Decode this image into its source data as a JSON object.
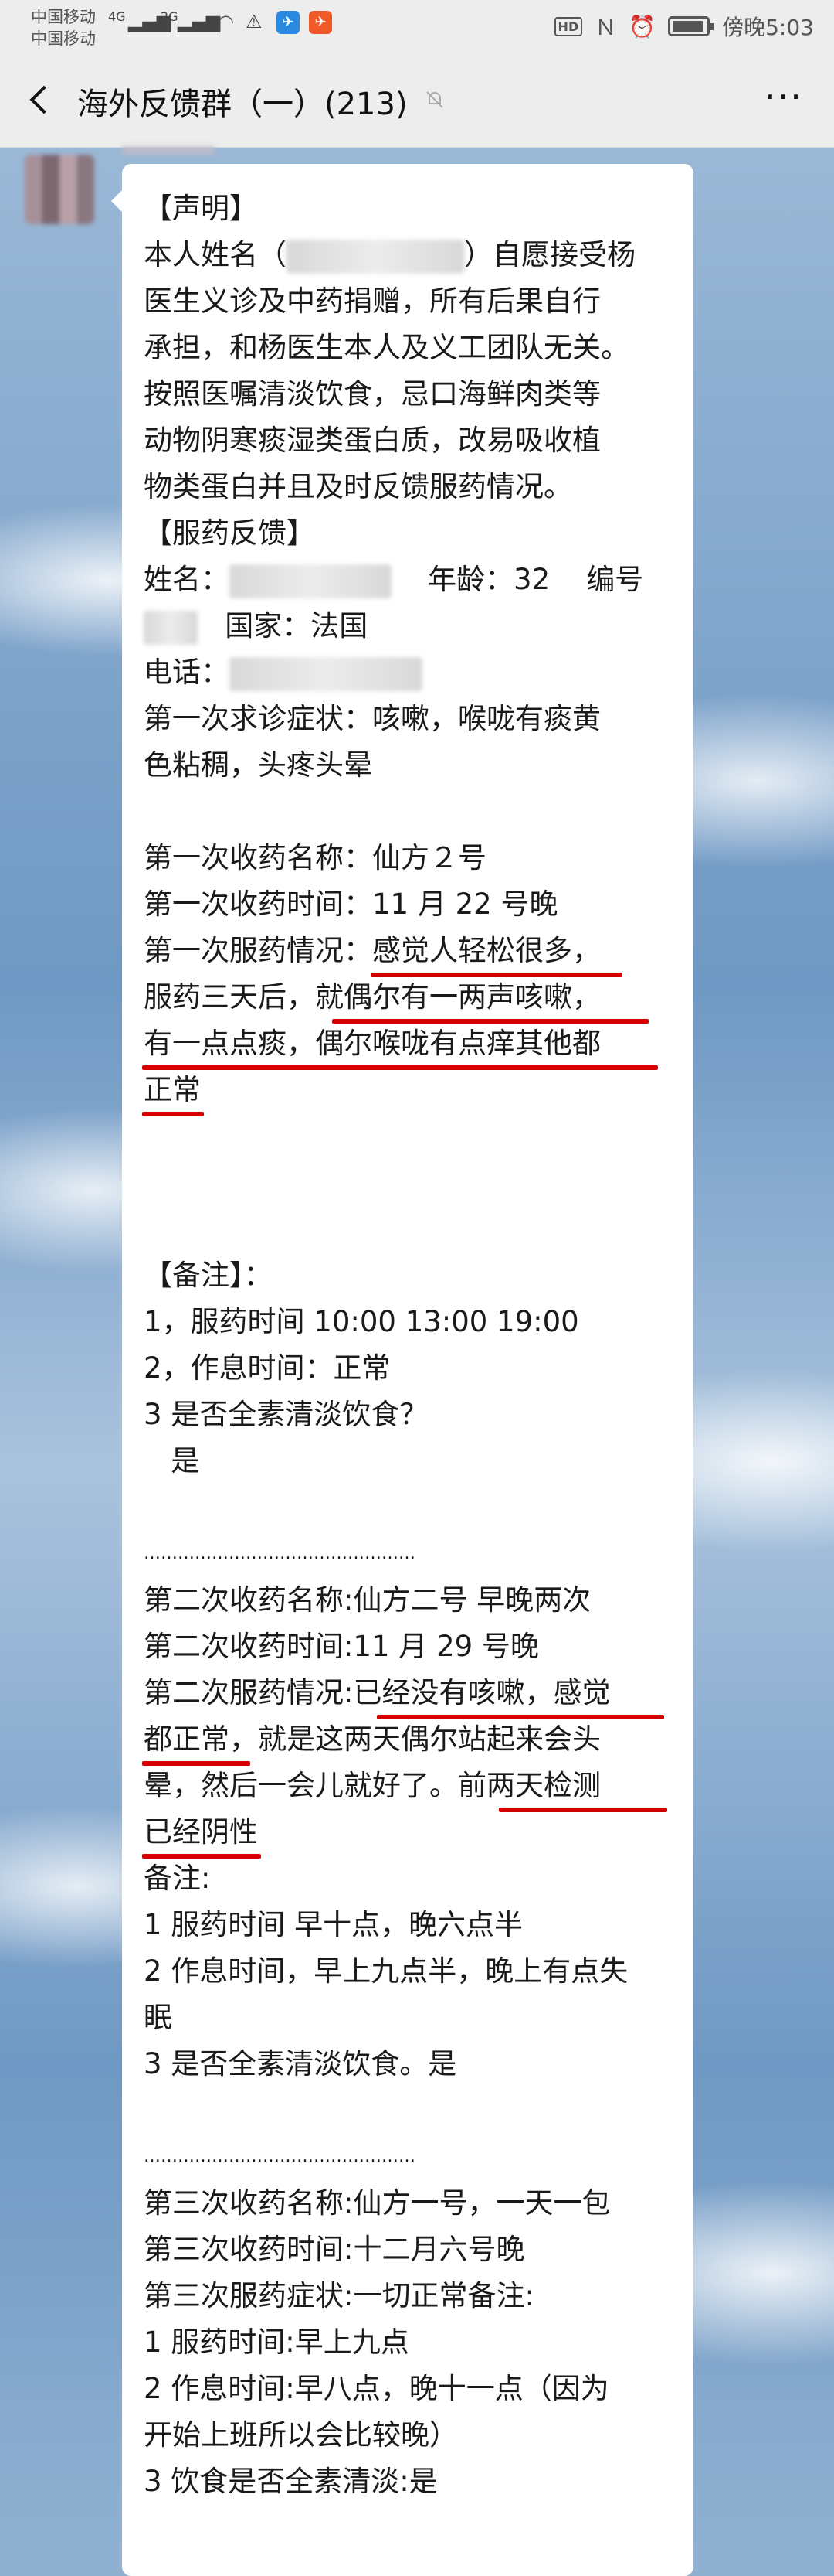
{
  "status_bar": {
    "carrier1": "中国移动",
    "carrier2": "中国移动",
    "net1": "4G",
    "net2": "2G",
    "time": "傍晚5:03"
  },
  "header": {
    "title": "海外反馈群（一）(213)",
    "more": "···"
  },
  "message": {
    "lines": [
      "【声明】",
      "本人姓名（",
      "）自愿接受杨",
      "医生义诊及中药捐赠，所有后果自行",
      "承担，和杨医生本人及义工团队无关。",
      "按照医嘱清淡饮食，忌口海鲜肉类等",
      "动物阴寒痰湿类蛋白质，改易吸收植",
      "物类蛋白并且及时反馈服药情况。",
      "【服药反馈】",
      "姓名：",
      "年龄：32",
      "编号",
      "国家：法国",
      "电话：",
      "第一次求诊症状：咳嗽，喉咙有痰黄",
      "色粘稠，头疼头晕",
      "第一次收药名称：仙方２号",
      "第一次收药时间：11 月 22 号晚",
      "第一次服药情况：感觉人轻松很多，",
      "服药三天后，就偶尔有一两声咳嗽，",
      "有一点点痰，偶尔喉咙有点痒其他都",
      "正常",
      "【备注】：",
      "1，服药时间 10:00 13:00 19:00",
      "2，作息时间：正常",
      "3 是否全素清淡饮食？",
      "   是",
      "…………………………………………",
      "第二次收药名称:仙方二号 早晚两次",
      "第二次收药时间:11 月 29 号晚",
      "第二次服药情况:已经没有咳嗽，感觉",
      "都正常，就是这两天偶尔站起来会头",
      "晕，然后一会儿就好了。前两天检测",
      "已经阴性",
      "备注:",
      "1 服药时间 早十点，晚六点半",
      "2 作息时间，早上九点半，晚上有点失",
      "眠",
      "3 是否全素清淡饮食。是",
      "…………………………………………",
      "第三次收药名称:仙方一号，一天一包",
      "第三次收药时间:十二月六号晚",
      "第三次服药症状:一切正常备注:",
      "1 服药时间:早上九点",
      "2 作息时间:早八点，晚十一点（因为",
      "开始上班所以会比较晚）",
      "3 饮食是否全素清淡:是"
    ]
  },
  "colors": {
    "highlight": "#d40000",
    "bubble": "#ffffff",
    "header_bg": "#ededed"
  }
}
